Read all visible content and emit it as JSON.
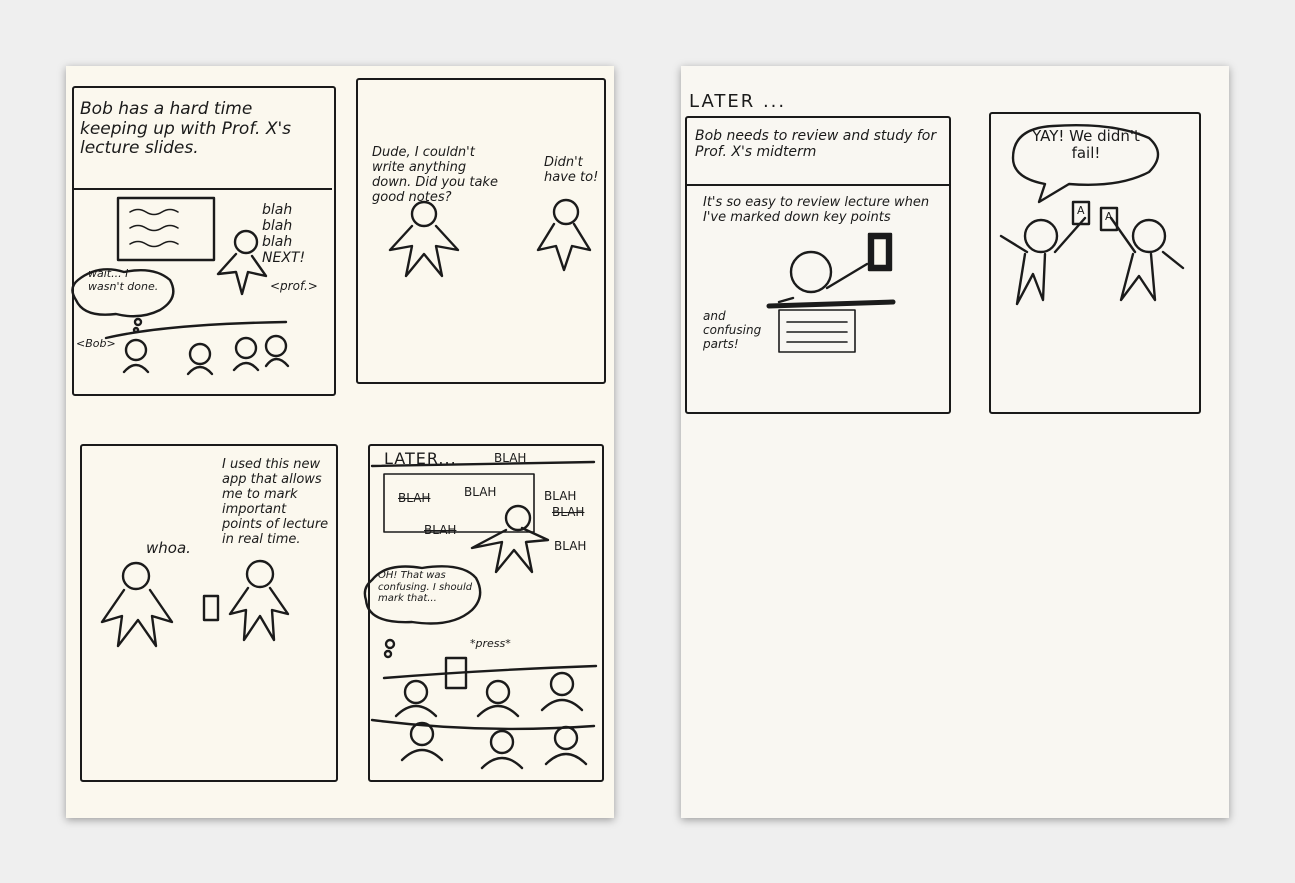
{
  "colors": {
    "background": "#efefef",
    "paper_left": "#fbf8ee",
    "paper_right": "#f9f7f2",
    "ink": "#1b1b1b"
  },
  "left_sheet": {
    "panel1": {
      "caption": "Bob has a hard time keeping up with Prof. X's lecture slides.",
      "speech": "blah blah blah NEXT!",
      "prof_label": "<prof.>",
      "thought": "wait... I wasn't done.",
      "bob_label": "<Bob>"
    },
    "panel2": {
      "speech_left": "Dude, I couldn't write anything down. Did you take good notes?",
      "speech_right": "Didn't have to!"
    },
    "panel3": {
      "speech_left": "whoa.",
      "speech_right": "I used this new app that allows me to mark important points of lecture in real time."
    },
    "panel4": {
      "header": "LATER...",
      "blah_words": [
        "BLAH",
        "BLAH",
        "BLAH",
        "BLAH",
        "BLAH",
        "BLAH",
        "BLAH"
      ],
      "thought": "OH! That was confusing. I should mark that...",
      "sfx": "*press*"
    }
  },
  "right_sheet": {
    "header": "LATER ...",
    "panel1": {
      "caption": "Bob needs to review and study for Prof. X's midterm",
      "speech_top": "It's so easy to review lecture when I've marked down key points",
      "speech_bottom": "and confusing parts!"
    },
    "panel2": {
      "speech": "YAY! We didn't fail!",
      "grade": "A"
    }
  }
}
